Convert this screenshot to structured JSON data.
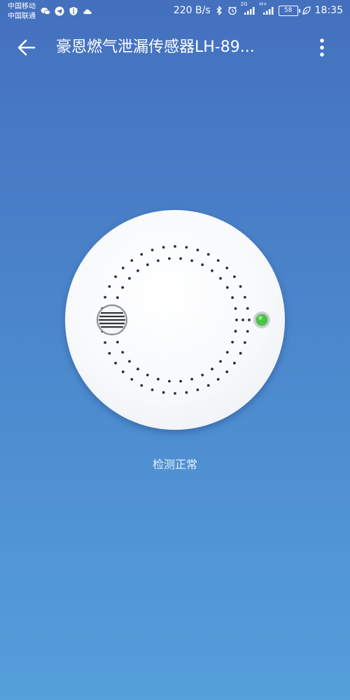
{
  "status_bar": {
    "carrier_1": "中国移动",
    "carrier_2": "中国联通",
    "left_icons": [
      "wechat-icon",
      "telegram-icon",
      "shield-icon",
      "cloud-icon"
    ],
    "net_speed": "220 B/s",
    "network_1": "2G",
    "network_2": "H+",
    "battery": "58",
    "time": "18:35"
  },
  "app_bar": {
    "title": "豪恩燃气泄漏传感器LH-89..."
  },
  "sensor": {
    "status": "检测正常",
    "indicator_color": "#4cc24c",
    "icons": [
      "grille-icon",
      "led-indicator-icon"
    ]
  },
  "colors": {
    "background_top": "#4470be",
    "background_bottom": "#559fdb",
    "sensor_body": "#f7f9fb"
  }
}
